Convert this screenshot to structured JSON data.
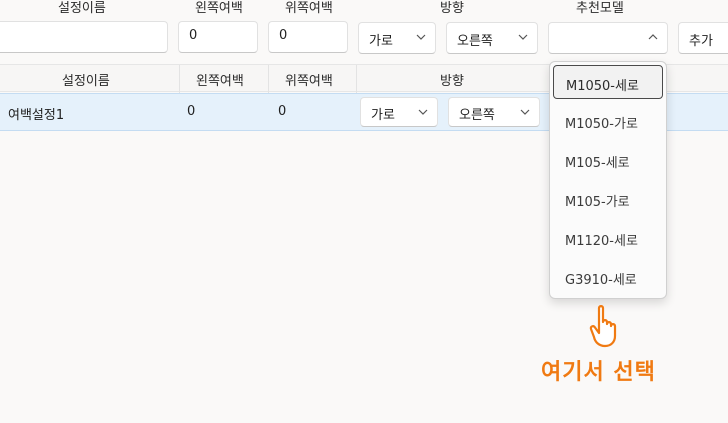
{
  "form": {
    "labels": {
      "setting_name": "설정이름",
      "left_margin": "왼쪽여백",
      "top_margin": "위쪽여백",
      "direction": "방향",
      "recommended_model": "추천모델"
    },
    "setting_name_value": "",
    "left_margin_value": "0",
    "top_margin_value": "0",
    "orientation_value": "가로",
    "direction_value": "오른쪽",
    "model_value": "",
    "add_button": "추가"
  },
  "grid": {
    "columns": [
      "설정이름",
      "왼쪽여백",
      "위쪽여백",
      "방향"
    ],
    "rows": [
      {
        "name": "여백설정1",
        "left": "0",
        "top": "0",
        "orientation": "가로",
        "direction": "오른쪽"
      }
    ]
  },
  "dropdown": {
    "options": [
      "M1050-세로",
      "M1050-가로",
      "M105-세로",
      "M105-가로",
      "M1120-세로",
      "G3910-세로"
    ],
    "selected_index": 0
  },
  "callout": {
    "text": "여기서 선택",
    "color": "#f07a12"
  },
  "icons": {
    "chevron": "chevron-down-icon",
    "pointer": "hand-pointer-icon"
  }
}
